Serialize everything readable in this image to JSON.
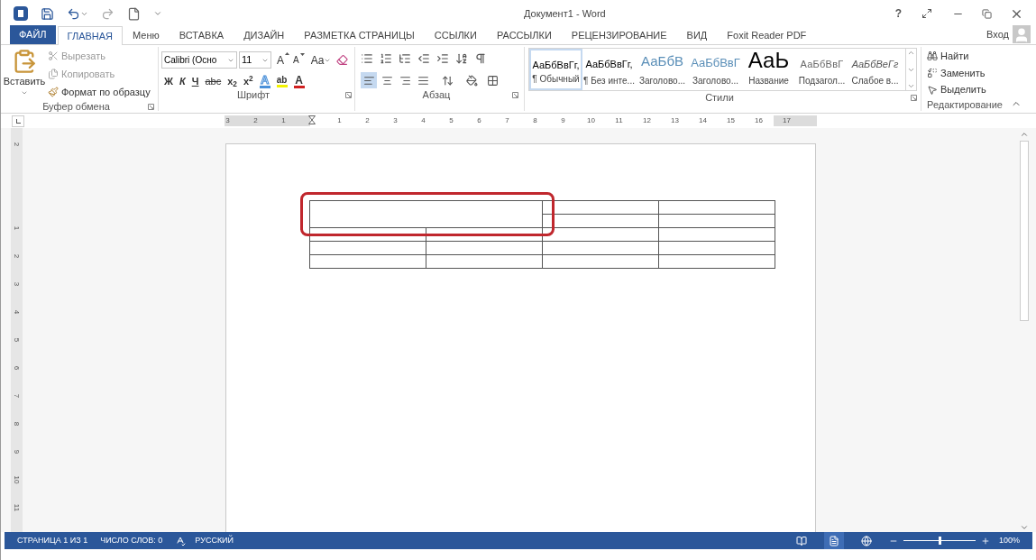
{
  "window": {
    "title": "Документ1 - Word",
    "help": "?"
  },
  "tabs": [
    {
      "label": "ФАЙЛ",
      "kind": "file",
      "selected": false
    },
    {
      "label": "ГЛАВНАЯ",
      "kind": "tab",
      "selected": true
    },
    {
      "label": "Меню",
      "kind": "tab",
      "selected": false
    },
    {
      "label": "ВСТАВКА",
      "kind": "tab",
      "selected": false
    },
    {
      "label": "ДИЗАЙН",
      "kind": "tab",
      "selected": false
    },
    {
      "label": "РАЗМЕТКА СТРАНИЦЫ",
      "kind": "tab",
      "selected": false
    },
    {
      "label": "ССЫЛКИ",
      "kind": "tab",
      "selected": false
    },
    {
      "label": "РАССЫЛКИ",
      "kind": "tab",
      "selected": false
    },
    {
      "label": "РЕЦЕНЗИРОВАНИЕ",
      "kind": "tab",
      "selected": false
    },
    {
      "label": "ВИД",
      "kind": "tab",
      "selected": false
    },
    {
      "label": "Foxit Reader PDF",
      "kind": "tab",
      "selected": false
    }
  ],
  "account": {
    "label": "Вход"
  },
  "clipboard": {
    "title": "Буфер обмена",
    "paste": "Вставить",
    "items": [
      {
        "label": "Вырезать",
        "kind": "cut",
        "disabled": true
      },
      {
        "label": "Копировать",
        "kind": "copy",
        "disabled": true
      },
      {
        "label": "Формат по образцу",
        "kind": "painter",
        "disabled": false
      }
    ]
  },
  "font": {
    "title": "Шрифт",
    "name": "Calibri (Осно",
    "size": "11",
    "top_buttons": [
      "A",
      "A",
      "Aa"
    ],
    "format_buttons": [
      {
        "label": "Ж",
        "kind": "bold"
      },
      {
        "label": "К",
        "kind": "italic"
      },
      {
        "label": "Ч",
        "kind": "underline"
      },
      {
        "label": "abc",
        "kind": "strike"
      },
      {
        "label": "x$_{2}$",
        "kind": "sub"
      },
      {
        "label": "x$^{2}$",
        "kind": "sup"
      }
    ],
    "color_buttons": [
      {
        "label": "A",
        "kind": "effects",
        "color": "#4a90d9"
      },
      {
        "label": "ab",
        "kind": "highlight",
        "color": "#f2f200"
      },
      {
        "label": "A",
        "kind": "font",
        "color": "#d02020"
      }
    ]
  },
  "paragraph": {
    "title": "Абзац",
    "align_buttons": [
      {
        "kind": "left",
        "selected": true
      },
      {
        "kind": "center",
        "selected": false
      },
      {
        "kind": "right",
        "selected": false
      },
      {
        "kind": "justify",
        "selected": false
      }
    ]
  },
  "styles": {
    "title": "Стили",
    "items": [
      {
        "sample": "АаБбВвГг,",
        "name": "¶ Обычный",
        "kind": "normal",
        "selected": true
      },
      {
        "sample": "АаБбВвГг,",
        "name": "¶ Без инте...",
        "kind": "normal",
        "selected": false
      },
      {
        "sample": "АаБбВ",
        "name": "Заголово...",
        "kind": "heading1",
        "selected": false
      },
      {
        "sample": "АаБбВвГ",
        "name": "Заголово...",
        "kind": "heading2",
        "selected": false
      },
      {
        "sample": "АаЬ",
        "name": "Название",
        "kind": "title",
        "selected": false
      },
      {
        "sample": "АаБбВвГ",
        "name": "Подзагол...",
        "kind": "subtitle",
        "selected": false
      },
      {
        "sample": "АаБбВеГг",
        "name": "Слабое в...",
        "kind": "emphasis",
        "selected": false
      }
    ]
  },
  "editing": {
    "title": "Редактирование",
    "items": [
      {
        "label": "Найти",
        "kind": "find"
      },
      {
        "label": "Заменить",
        "kind": "replace"
      },
      {
        "label": "Выделить",
        "kind": "select"
      }
    ]
  },
  "ruler": {
    "marks": [
      {
        "kind": "number",
        "label": "3"
      },
      {
        "kind": "number",
        "label": "2"
      },
      {
        "kind": "number",
        "label": "1"
      },
      {
        "kind": "indent-marker"
      },
      {
        "kind": "number",
        "label": "1"
      },
      {
        "kind": "number",
        "label": "2"
      },
      {
        "kind": "number",
        "label": "3"
      },
      {
        "kind": "number",
        "label": "4"
      },
      {
        "kind": "number",
        "label": "5"
      },
      {
        "kind": "number",
        "label": "6"
      },
      {
        "kind": "number",
        "label": "7"
      },
      {
        "kind": "number",
        "label": "8"
      },
      {
        "kind": "number",
        "label": "9"
      },
      {
        "kind": "number",
        "label": "10"
      },
      {
        "kind": "number",
        "label": "11"
      },
      {
        "kind": "number",
        "label": "12"
      },
      {
        "kind": "number",
        "label": "13"
      },
      {
        "kind": "number",
        "label": "14"
      },
      {
        "kind": "number",
        "label": "15"
      },
      {
        "kind": "number",
        "label": "16"
      },
      {
        "kind": "number",
        "label": "17"
      }
    ]
  },
  "vertical_ruler": {
    "labels": [
      "2",
      "1",
      "2",
      "3",
      "4",
      "5",
      "6",
      "7",
      "8",
      "9",
      "10",
      "11"
    ]
  },
  "table": {
    "highlighted": true,
    "rows": [
      {
        "cells": [
          {
            "kind": "wide"
          },
          {
            "kind": "plain"
          },
          {
            "kind": "plain"
          }
        ]
      },
      {
        "cells": [
          {
            "kind": "plain"
          },
          {
            "kind": "plain"
          }
        ]
      },
      {
        "cells": [
          {
            "kind": "plain"
          },
          {
            "kind": "plain"
          },
          {
            "kind": "plain"
          },
          {
            "kind": "plain"
          }
        ]
      },
      {
        "cells": [
          {
            "kind": "plain"
          },
          {
            "kind": "plain"
          },
          {
            "kind": "plain"
          },
          {
            "kind": "plain"
          }
        ]
      },
      {
        "cells": [
          {
            "kind": "plain"
          },
          {
            "kind": "plain"
          },
          {
            "kind": "plain"
          },
          {
            "kind": "plain"
          }
        ]
      }
    ]
  },
  "status_bar": {
    "page": "СТРАНИЦА 1 ИЗ 1",
    "words": "ЧИСЛО СЛОВ: 0",
    "language": "РУССКИЙ",
    "views": [
      {
        "kind": "read",
        "selected": false
      },
      {
        "kind": "print",
        "selected": true
      },
      {
        "kind": "web",
        "selected": false
      }
    ],
    "zoom": {
      "level": 0.5,
      "reading": "100%"
    }
  }
}
